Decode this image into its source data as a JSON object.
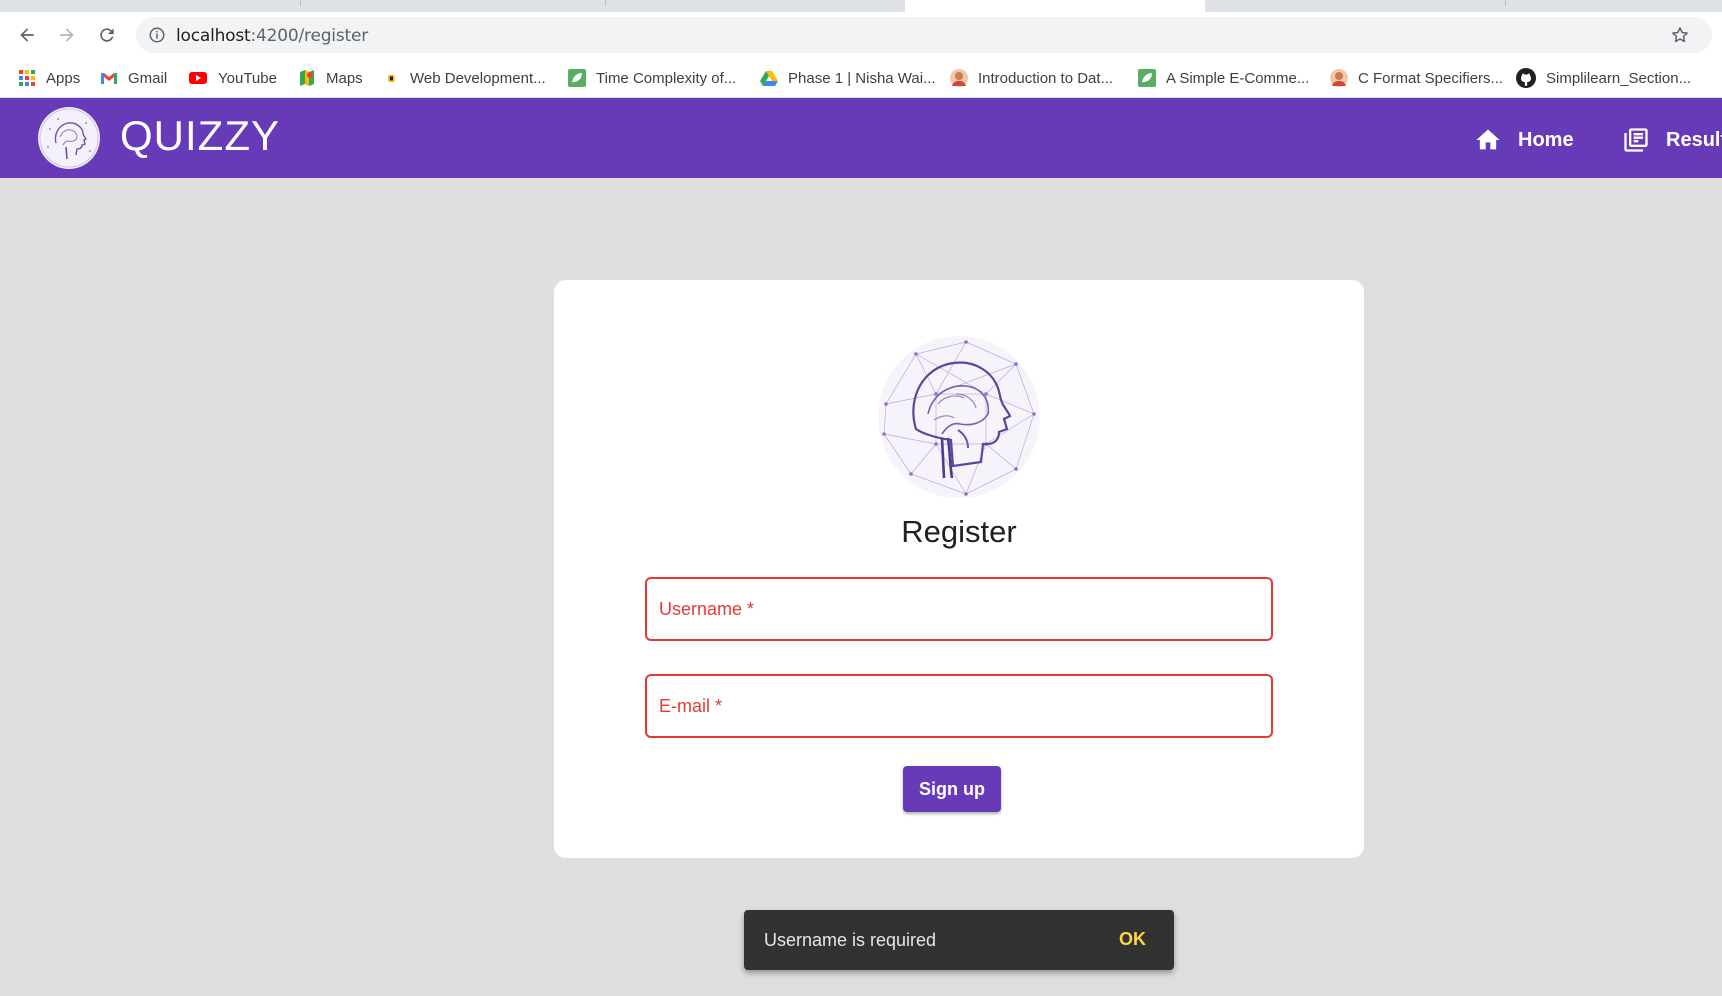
{
  "browser": {
    "url_host": "localhost",
    "url_path": ":4200/register",
    "bookmarks": [
      {
        "label": "Apps",
        "icon": "apps-grid-icon"
      },
      {
        "label": "Gmail",
        "icon": "gmail-icon"
      },
      {
        "label": "YouTube",
        "icon": "youtube-icon"
      },
      {
        "label": "Maps",
        "icon": "maps-icon"
      },
      {
        "label": "Web Development...",
        "icon": "web-dev-icon"
      },
      {
        "label": "Time Complexity of...",
        "icon": "leaf-icon"
      },
      {
        "label": "Phase 1 | Nisha Wai...",
        "icon": "google-drive-icon"
      },
      {
        "label": "Introduction to Dat...",
        "icon": "avatar-icon"
      },
      {
        "label": "A Simple E-Comme...",
        "icon": "leaf-icon"
      },
      {
        "label": "C Format Specifiers...",
        "icon": "avatar-icon"
      },
      {
        "label": "Simplilearn_Section...",
        "icon": "github-icon"
      }
    ]
  },
  "app": {
    "title": "QUIZZY",
    "nav": {
      "home": "Home",
      "results": "Results"
    },
    "colors": {
      "primary": "#673ab7",
      "error": "#e53935",
      "accent": "#ffd740"
    }
  },
  "register": {
    "title": "Register",
    "username_label": "Username *",
    "email_label": "E-mail *",
    "submit_label": "Sign up"
  },
  "snackbar": {
    "message": "Username is required",
    "action": "OK"
  }
}
